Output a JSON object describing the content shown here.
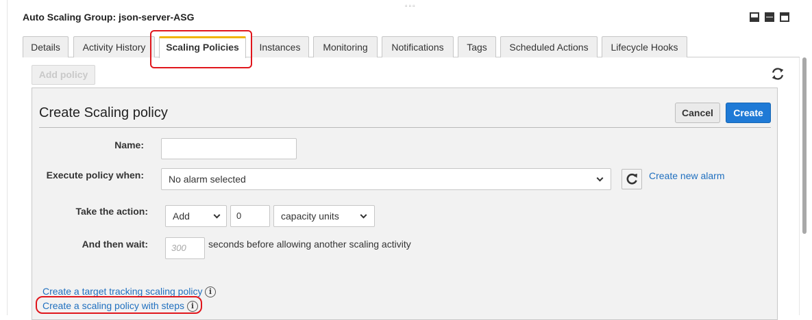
{
  "panel": {
    "title": "Auto Scaling Group: json-server-ASG"
  },
  "tabs": [
    {
      "label": "Details"
    },
    {
      "label": "Activity History"
    },
    {
      "label": "Scaling Policies",
      "active": true
    },
    {
      "label": "Instances"
    },
    {
      "label": "Monitoring"
    },
    {
      "label": "Notifications"
    },
    {
      "label": "Tags"
    },
    {
      "label": "Scheduled Actions"
    },
    {
      "label": "Lifecycle Hooks"
    }
  ],
  "toolbar": {
    "add_policy_label": "Add policy",
    "refresh_icon": "refresh-icon"
  },
  "form": {
    "title": "Create Scaling policy",
    "cancel_label": "Cancel",
    "create_label": "Create",
    "name_label": "Name:",
    "name_value": "",
    "execute_label": "Execute policy when:",
    "alarm_selected": "No alarm selected",
    "create_alarm_link": "Create new alarm",
    "action_label": "Take the action:",
    "action_type": "Add",
    "action_amount": "0",
    "action_unit": "capacity units",
    "wait_label": "And then wait:",
    "wait_placeholder": "300",
    "wait_suffix": "seconds before allowing another scaling activity",
    "target_tracking_link": "Create a target tracking scaling policy",
    "steps_link": "Create a scaling policy with steps",
    "info_glyph": "i"
  },
  "colors": {
    "primary_button": "#1f7ad6",
    "link": "#1f6fbf",
    "highlight": "#e0151b",
    "active_tab_accent": "#f0b400"
  }
}
